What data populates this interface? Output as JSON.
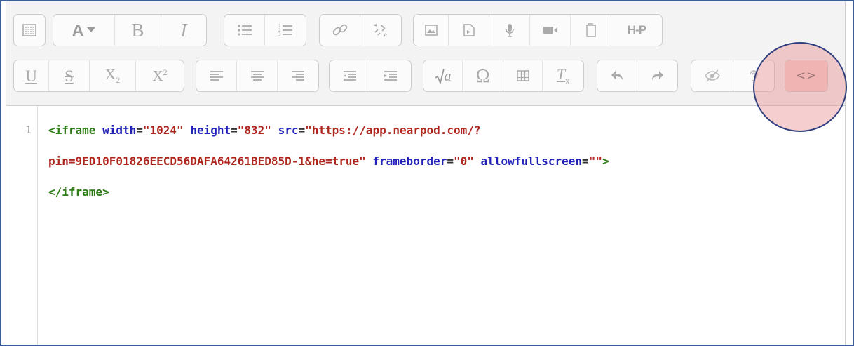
{
  "toolbar": {
    "row1_groups": [
      [
        "show-more-buttons-icon"
      ],
      [
        "font-color-icon",
        "bold-icon",
        "italic-icon"
      ],
      [
        "unordered-list-icon",
        "ordered-list-icon"
      ],
      [
        "link-icon",
        "unlink-icon"
      ],
      [
        "image-icon",
        "media-icon",
        "record-audio-icon",
        "record-video-icon",
        "manage-files-icon",
        "h5p-icon"
      ]
    ],
    "row2_groups": [
      [
        "underline-icon",
        "strikethrough-icon",
        "subscript-icon",
        "superscript-icon"
      ],
      [
        "align-left-icon",
        "align-center-icon",
        "align-right-icon"
      ],
      [
        "outdent-icon",
        "indent-icon"
      ],
      [
        "equation-icon",
        "special-character-icon",
        "table-icon",
        "clear-formatting-icon"
      ],
      [
        "undo-icon",
        "redo-icon"
      ],
      [
        "accessibility-checker-icon",
        "screenreader-helper-icon"
      ],
      [
        "html-toggle-icon"
      ]
    ],
    "labels": {
      "bold": "B",
      "italic": "I",
      "underline": "U",
      "strike": "S",
      "sub_base": "X",
      "sub_idx": "2",
      "sup_base": "X",
      "sup_idx": "2",
      "omega": "Ω",
      "clear_base": "T",
      "clear_sub": "x",
      "h5p": "H-P",
      "sqrt_var": "a",
      "html_toggle": "<>"
    }
  },
  "code": {
    "line_number": "1",
    "line1": {
      "open": "<iframe",
      "a1": "width",
      "v1": "\"1024\"",
      "a2": "height",
      "v2": "\"832\"",
      "a3": "src",
      "v3": "\"https://app.nearpod.com/?"
    },
    "line2": {
      "v3b": "pin=9ED10F01826EECD56DAFA64261BED85D-1&he=true\"",
      "a4": "frameborder",
      "v4": "\"0\"",
      "a5": "allowfullscreen",
      "v5": "\"\"",
      "close": ">"
    },
    "line3": {
      "end": "</iframe>"
    }
  },
  "colors": {
    "tag": "#2e7d17",
    "attribute": "#2222bb",
    "string": "#b0261f",
    "frame_border": "#3e5c95",
    "highlight_fill": "#e78c8c",
    "highlight_border": "#2f3e7d"
  }
}
